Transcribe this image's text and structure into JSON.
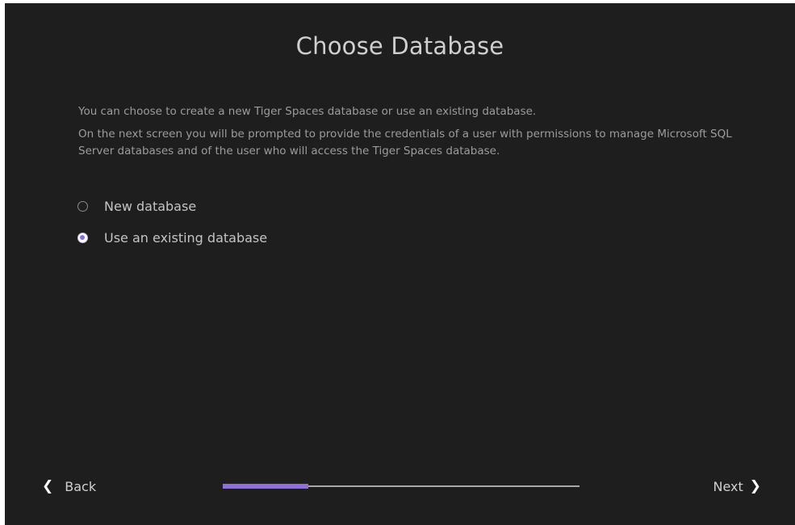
{
  "dialog": {
    "title": "Choose Database",
    "intro_line1": "You can choose to create a new Tiger Spaces database or use an existing database.",
    "intro_line2": "On the next screen you will be prompted to provide the credentials of a user with permissions to manage Microsoft SQL Server databases and of the user who will access the Tiger Spaces database."
  },
  "options": [
    {
      "label": "New database",
      "selected": false
    },
    {
      "label": "Use an existing database",
      "selected": true
    }
  ],
  "footer": {
    "back_label": "Back",
    "next_label": "Next",
    "back_icon": "chevron-left-icon",
    "next_icon": "chevron-right-icon",
    "progress_fraction": 0.24,
    "progress_color": "#8d72d3"
  },
  "colors": {
    "background": "#1e1e1e",
    "accent": "#8d72d3"
  }
}
